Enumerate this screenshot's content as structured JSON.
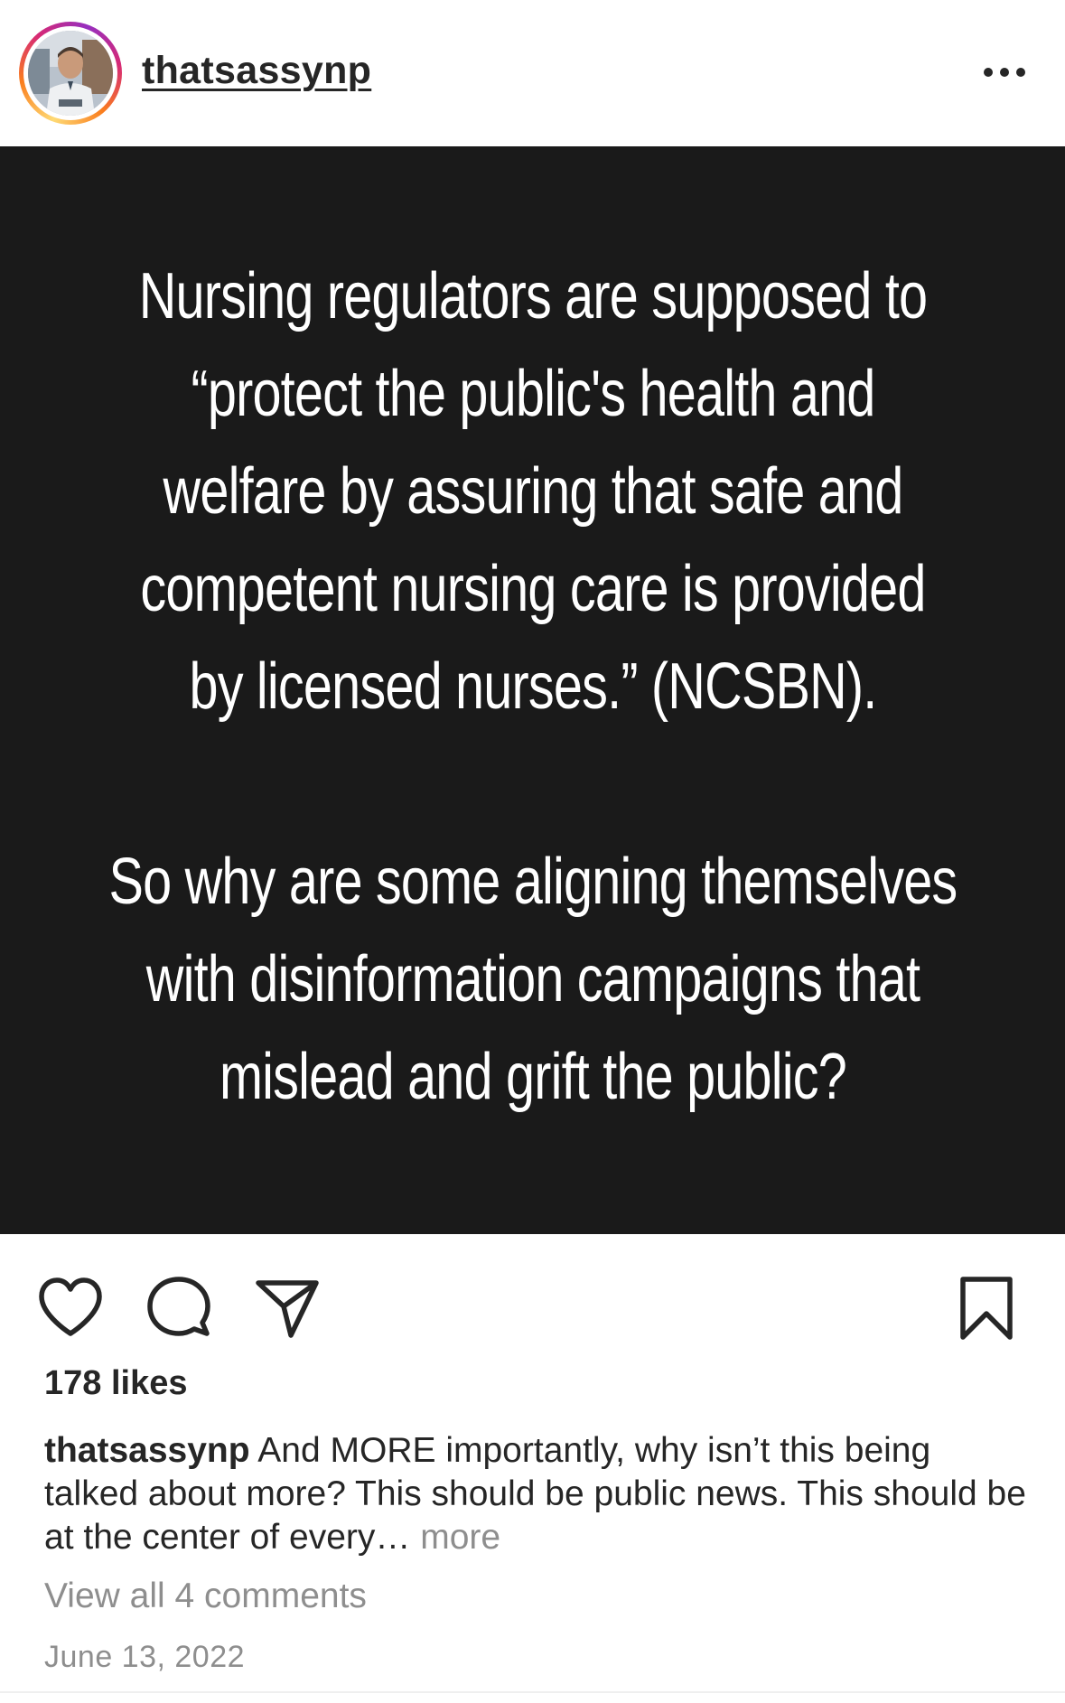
{
  "header": {
    "username": "thatsassynp",
    "more_icon": "ellipsis-horizontal-icon"
  },
  "post": {
    "background_color": "#1a1a1a",
    "paragraph_1": [
      "Nursing regulators are supposed to",
      "“protect the public's health and",
      "welfare by assuring that safe and",
      "competent nursing care is provided",
      "by licensed nurses.” (NCSBN)."
    ],
    "paragraph_2": [
      "So why are some aligning themselves",
      "with disinformation campaigns that",
      "mislead and grift the public?"
    ]
  },
  "actions": {
    "like_icon": "heart-icon",
    "comment_icon": "comment-bubble-icon",
    "share_icon": "send-icon",
    "save_icon": "bookmark-icon"
  },
  "likes": "178 likes",
  "caption": {
    "username": "thatsassynp",
    "text": " And MORE importantly, why isn’t this being talked about more? This should be public news. This should be at the center of every… ",
    "more": "more"
  },
  "comments_link": "View all 4 comments",
  "date": "June 13, 2022"
}
